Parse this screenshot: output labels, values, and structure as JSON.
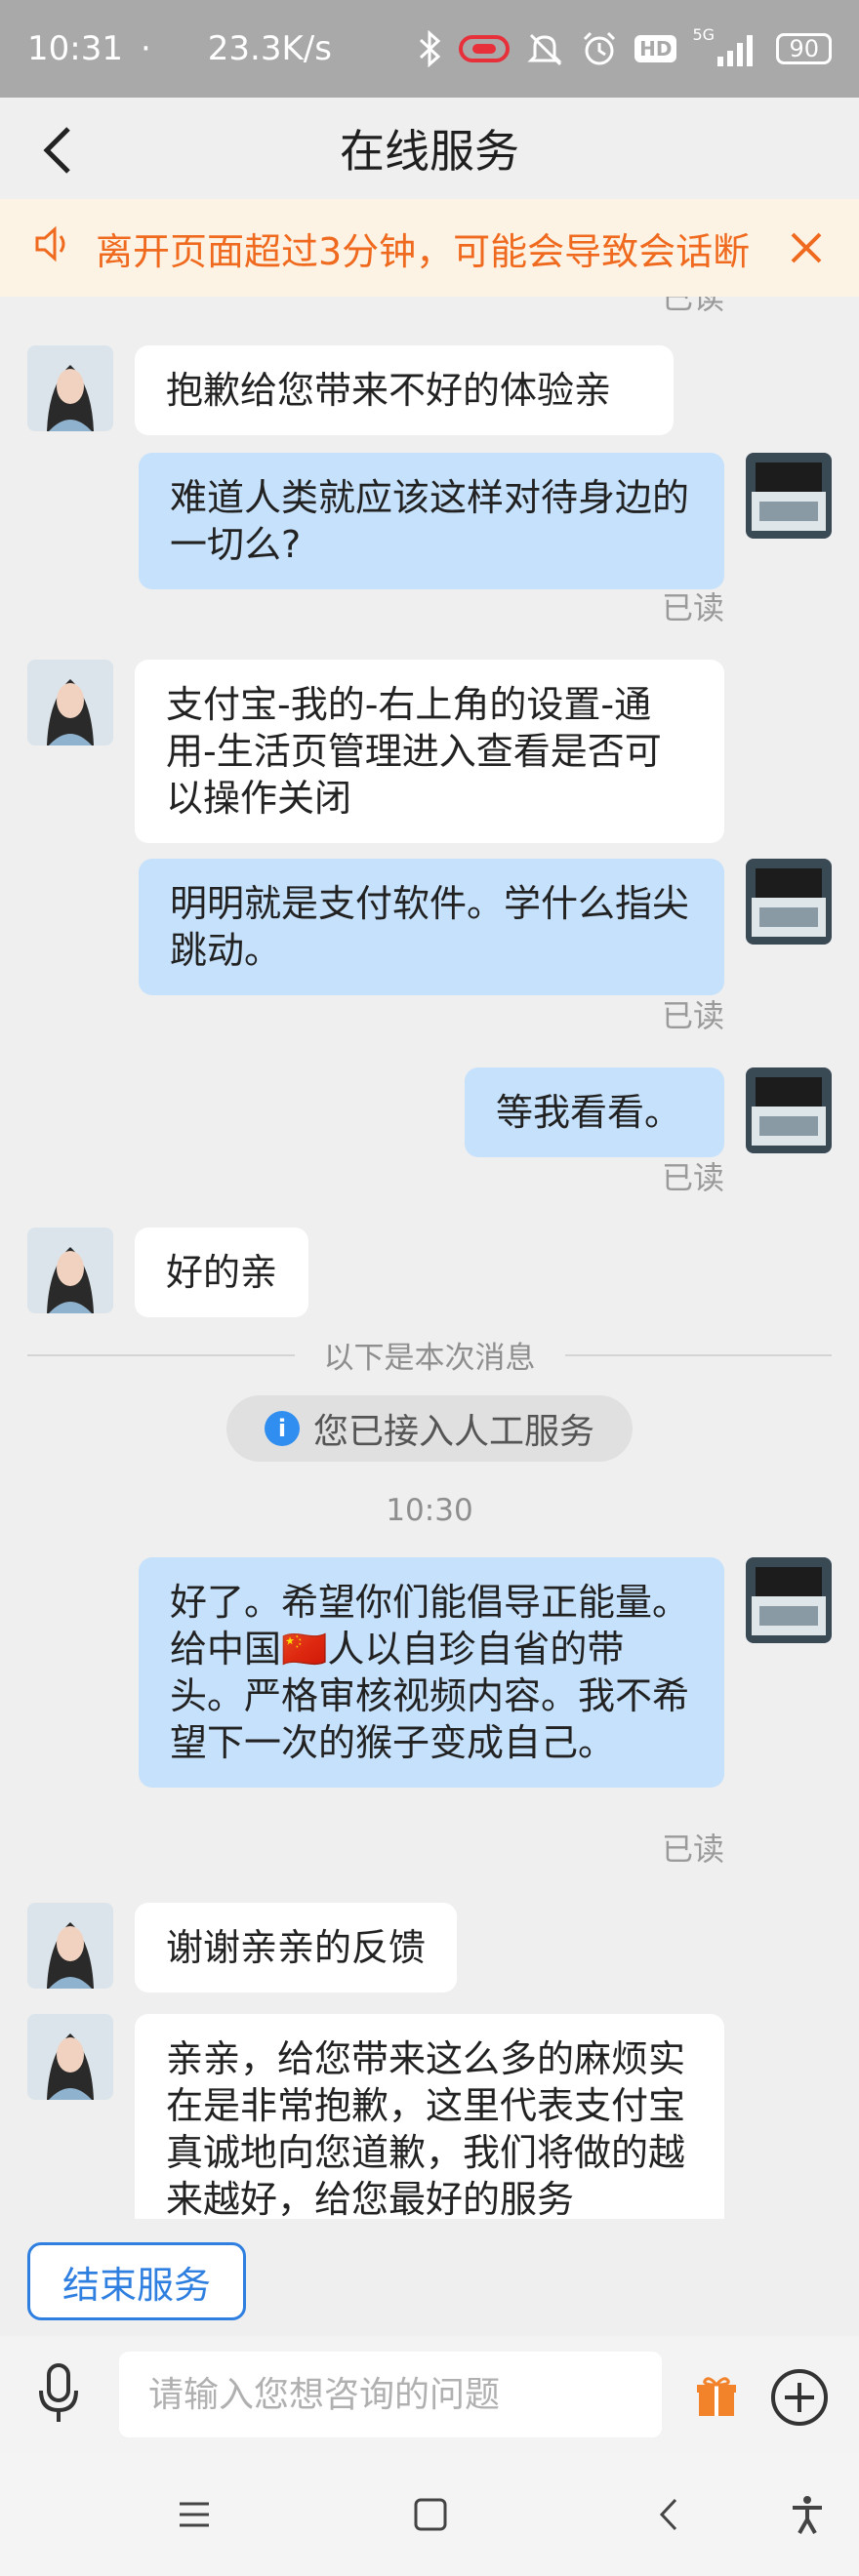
{
  "status_bar": {
    "time": "10:31",
    "dot": "·",
    "net_speed": "23.3K/s",
    "hd": "HD",
    "signal_label": "5G",
    "battery": "90",
    "icons": [
      "bluetooth-icon",
      "link-icon",
      "mute-icon",
      "alarm-icon",
      "hd-icon",
      "signal-icon",
      "battery-icon"
    ]
  },
  "header": {
    "title": "在线服务"
  },
  "notice": {
    "text": "离开页面超过3分钟，可能会导致会话断"
  },
  "chat": {
    "top_partial_read": "已读",
    "messages": [
      {
        "side": "in",
        "text": "抱歉给您带来不好的体验亲"
      },
      {
        "side": "out",
        "text": "难道人类就应该这样对待身边的一切么?",
        "status": "已读"
      },
      {
        "side": "in",
        "text": "支付宝-我的-右上角的设置-通用-生活页管理进入查看是否可以操作关闭"
      },
      {
        "side": "out",
        "text": "明明就是支付软件。学什么指尖跳动。",
        "status": "已读"
      },
      {
        "side": "out",
        "text": "等我看看。",
        "status": "已读"
      },
      {
        "side": "in",
        "text": "好的亲"
      },
      {
        "side": "out",
        "text": "好了。希望你们能倡导正能量。给中国🇨🇳人以自珍自省的带头。严格审核视频内容。我不希望下一次的猴子变成自己。",
        "status": "已读"
      },
      {
        "side": "in",
        "text": "谢谢亲亲的反馈"
      },
      {
        "side": "in",
        "text": "亲亲，给您带来这么多的麻烦实在是非常抱歉，这里代表支付宝真诚地向您道歉，我们将做的越来越好，给您最好的服务"
      }
    ],
    "divider": "以下是本次消息",
    "system_notice": "您已接入人工服务",
    "timestamp": "10:30"
  },
  "end_service": {
    "label": "结束服务"
  },
  "input": {
    "placeholder": "请输入您想咨询的问题",
    "value": ""
  },
  "colors": {
    "accent": "#2f7fe0",
    "notice_orange": "#ef6a1e",
    "out_bubble": "#c6e1fb"
  }
}
